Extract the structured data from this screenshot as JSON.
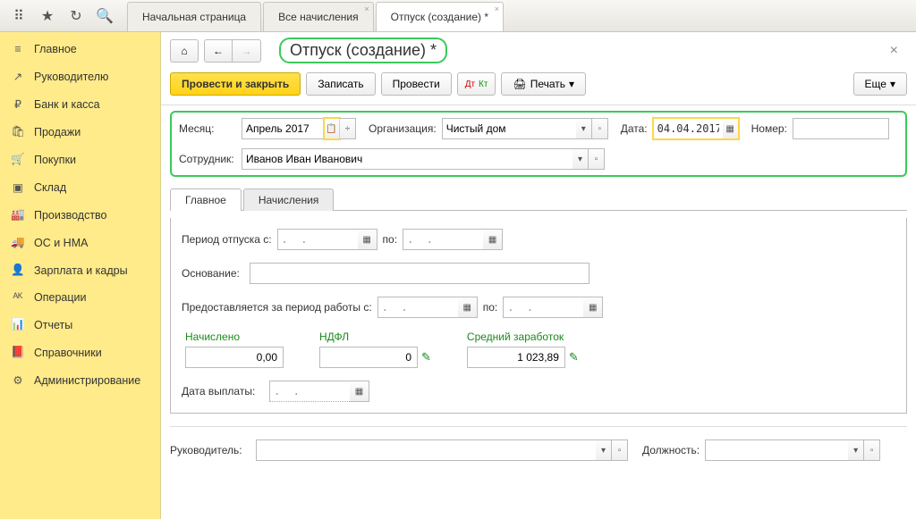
{
  "tabs": {
    "t0": "Начальная страница",
    "t1": "Все начисления",
    "t2": "Отпуск (создание) *"
  },
  "sidebar": {
    "items": [
      {
        "label": "Главное",
        "icon": "≡"
      },
      {
        "label": "Руководителю",
        "icon": "↗"
      },
      {
        "label": "Банк и касса",
        "icon": "₽"
      },
      {
        "label": "Продажи",
        "icon": "🛍"
      },
      {
        "label": "Покупки",
        "icon": "🛒"
      },
      {
        "label": "Склад",
        "icon": "▣"
      },
      {
        "label": "Производство",
        "icon": "🏭"
      },
      {
        "label": "ОС и НМА",
        "icon": "🚚"
      },
      {
        "label": "Зарплата и кадры",
        "icon": "👤"
      },
      {
        "label": "Операции",
        "icon": "ᴬᴷ"
      },
      {
        "label": "Отчеты",
        "icon": "📊"
      },
      {
        "label": "Справочники",
        "icon": "📕"
      },
      {
        "label": "Администрирование",
        "icon": "⚙"
      }
    ]
  },
  "header": {
    "title": "Отпуск (создание) *"
  },
  "toolbar": {
    "post_close": "Провести и закрыть",
    "write": "Записать",
    "post": "Провести",
    "print_label": "Печать",
    "more": "Еще"
  },
  "form": {
    "month_label": "Месяц:",
    "month_value": "Апрель 2017",
    "org_label": "Организация:",
    "org_value": "Чистый дом",
    "date_label": "Дата:",
    "date_value": "04.04.2017",
    "number_label": "Номер:",
    "number_value": "",
    "employee_label": "Сотрудник:",
    "employee_value": "Иванов Иван Иванович",
    "inner_tabs": {
      "main": "Главное",
      "accruals": "Начисления"
    },
    "period_label": "Период отпуска с:",
    "period_to": "по:",
    "empty_date": ".  .",
    "basis_label": "Основание:",
    "work_period_label": "Предоставляется за период работы с:",
    "calc": {
      "accrued_lbl": "Начислено",
      "accrued_val": "0,00",
      "ndfl_lbl": "НДФЛ",
      "ndfl_val": "0",
      "avg_lbl": "Средний заработок",
      "avg_val": "1 023,89"
    },
    "pay_date_label": "Дата выплаты:",
    "manager_label": "Руководитель:",
    "position_label": "Должность:"
  }
}
